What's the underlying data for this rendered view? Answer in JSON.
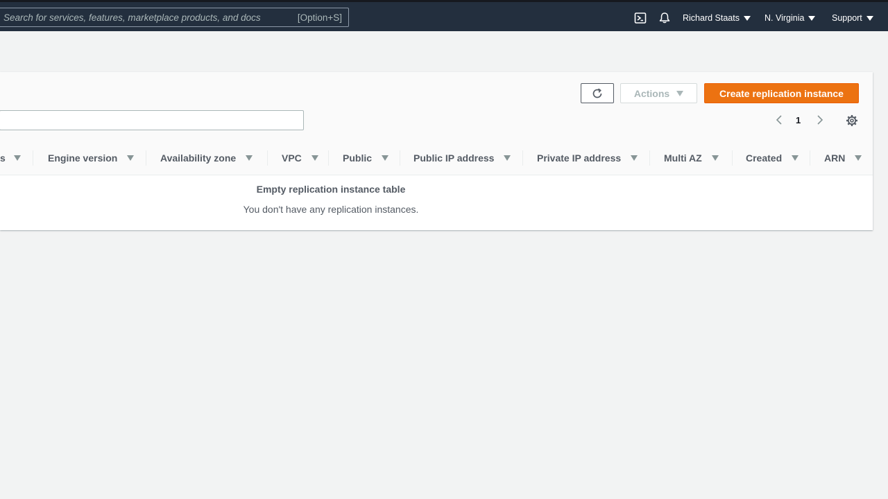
{
  "topnav": {
    "search_placeholder": "Search for services, features, marketplace products, and docs",
    "search_shortcut": "[Option+S]",
    "user_menu": "Richard Staats",
    "region_menu": "N. Virginia",
    "support_menu": "Support",
    "icons": [
      "cloudshell-icon",
      "notifications-bell-icon"
    ]
  },
  "toolbar": {
    "refresh_icon": "refresh-icon",
    "actions_label": "Actions",
    "create_label": "Create replication instance"
  },
  "pagination": {
    "current_page": "1"
  },
  "table": {
    "columns": [
      "s",
      "Engine version",
      "Availability zone",
      "VPC",
      "Public",
      "Public IP address",
      "Private IP address",
      "Multi AZ",
      "Created",
      "ARN"
    ],
    "empty_title": "Empty replication instance table",
    "empty_description": "You don't have any replication instances."
  },
  "colors": {
    "nav_bg": "#232f3e",
    "primary_button": "#ec7211",
    "page_bg": "#f2f3f3"
  }
}
